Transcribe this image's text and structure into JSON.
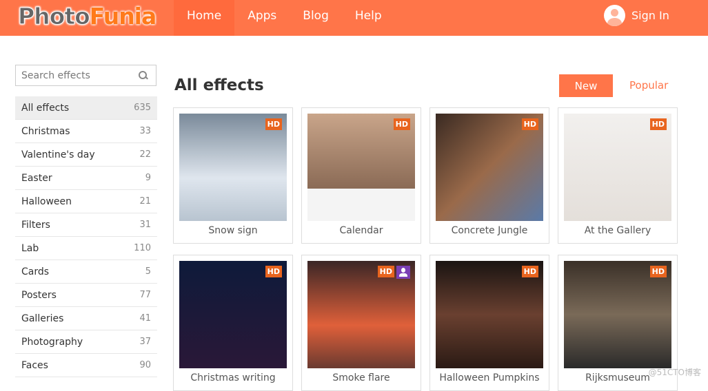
{
  "header": {
    "logo_part1": "Photo",
    "logo_part2": "Funia",
    "nav": [
      "Home",
      "Apps",
      "Blog",
      "Help"
    ],
    "active_nav": "Home",
    "sign_in": "Sign In",
    "accent": "#ff7549"
  },
  "search": {
    "placeholder": "Search effects"
  },
  "categories": [
    {
      "label": "All effects",
      "count": "635"
    },
    {
      "label": "Christmas",
      "count": "33"
    },
    {
      "label": "Valentine's day",
      "count": "22"
    },
    {
      "label": "Easter",
      "count": "9"
    },
    {
      "label": "Halloween",
      "count": "21"
    },
    {
      "label": "Filters",
      "count": "31"
    },
    {
      "label": "Lab",
      "count": "110"
    },
    {
      "label": "Cards",
      "count": "5"
    },
    {
      "label": "Posters",
      "count": "77"
    },
    {
      "label": "Galleries",
      "count": "41"
    },
    {
      "label": "Photography",
      "count": "37"
    },
    {
      "label": "Faces",
      "count": "90"
    }
  ],
  "main": {
    "title": "All effects",
    "sort_new": "New",
    "sort_popular": "Popular"
  },
  "effects": [
    {
      "label": "Snow sign",
      "badge": "HD",
      "bg": "linear-gradient(#7a8a9a,#dfe6ee 60%,#b8c4d0)"
    },
    {
      "label": "Calendar",
      "badge": "HD",
      "bg": "linear-gradient(#c9a58a,#8a6a55 70%,#f4f4f4 70%)"
    },
    {
      "label": "Concrete Jungle",
      "badge": "HD",
      "bg": "linear-gradient(135deg,#3a2a22,#9a6a4a 50%,#5a7aa8)"
    },
    {
      "label": "At the Gallery",
      "badge": "HD",
      "bg": "linear-gradient(#f2f0ee,#e4dfda)"
    },
    {
      "label": "Christmas writing",
      "badge": "HD",
      "bg": "linear-gradient(#0e1a3a,#2a1838)"
    },
    {
      "label": "Smoke flare",
      "badge": "HD",
      "user": true,
      "bg": "linear-gradient(#3a2626,#e0603a 60%,#6a3a30)"
    },
    {
      "label": "Halloween Pumpkins",
      "badge": "HD",
      "bg": "linear-gradient(#1a1412,#6a4030 50%,#2a1a14)"
    },
    {
      "label": "Rijksmuseum",
      "badge": "HD",
      "bg": "linear-gradient(#3a3028,#7a6a58 50%,#2a2a2a)"
    }
  ],
  "watermark": "@51CTO博客"
}
